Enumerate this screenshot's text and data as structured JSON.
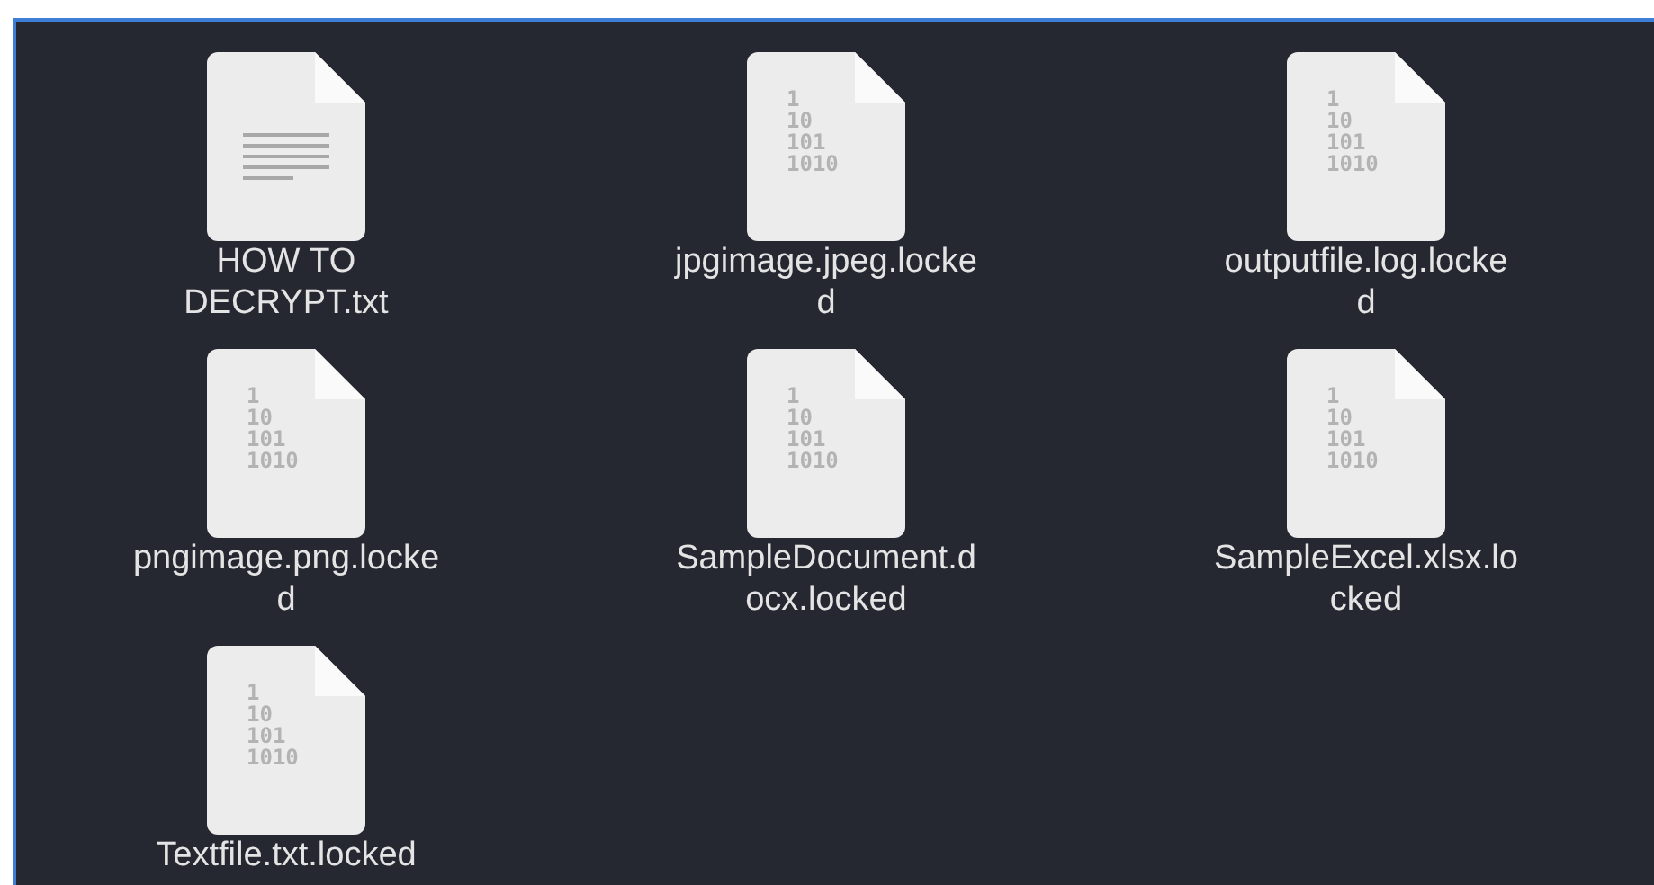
{
  "files": [
    {
      "kind": "text",
      "label_lines": [
        "HOW TO",
        "DECRYPT.txt"
      ]
    },
    {
      "kind": "binary",
      "icon_text": [
        "1",
        "10",
        "101",
        "1010"
      ],
      "label_lines": [
        "jpgimage.jpeg.locke",
        "d"
      ]
    },
    {
      "kind": "binary",
      "icon_text": [
        "1",
        "10",
        "101",
        "1010"
      ],
      "label_lines": [
        "outputfile.log.locke",
        "d"
      ]
    },
    {
      "kind": "binary",
      "icon_text": [
        "1",
        "10",
        "101",
        "1010"
      ],
      "label_lines": [
        "pngimage.png.locke",
        "d"
      ]
    },
    {
      "kind": "binary",
      "icon_text": [
        "1",
        "10",
        "101",
        "1010"
      ],
      "label_lines": [
        "SampleDocument.d",
        "ocx.locked"
      ]
    },
    {
      "kind": "binary",
      "icon_text": [
        "1",
        "10",
        "101",
        "1010"
      ],
      "label_lines": [
        "SampleExcel.xlsx.lo",
        "cked"
      ]
    },
    {
      "kind": "binary",
      "icon_text": [
        "1",
        "10",
        "101",
        "1010"
      ],
      "label_lines": [
        "Textfile.txt.locked"
      ]
    }
  ]
}
